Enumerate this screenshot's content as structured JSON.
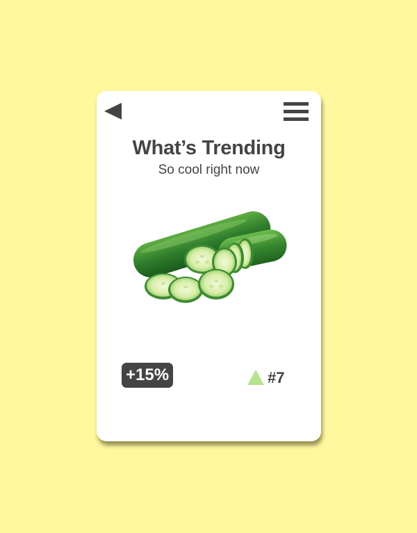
{
  "header": {
    "back_icon": "back-arrow-icon",
    "menu_icon": "hamburger-menu-icon"
  },
  "card": {
    "title": "What’s Trending",
    "subtitle": "So cool right now",
    "product_image": "cucumber-image",
    "change": "+15%",
    "rank_icon": "trend-up-triangle-icon",
    "rank": "#7"
  },
  "colors": {
    "background": "#fff89e",
    "card": "#ffffff",
    "text": "#444444",
    "badge": "#444444",
    "trend_up": "#b6e38c",
    "cucumber_dark": "#2d7a2b",
    "cucumber_light": "#cfe9a6"
  }
}
